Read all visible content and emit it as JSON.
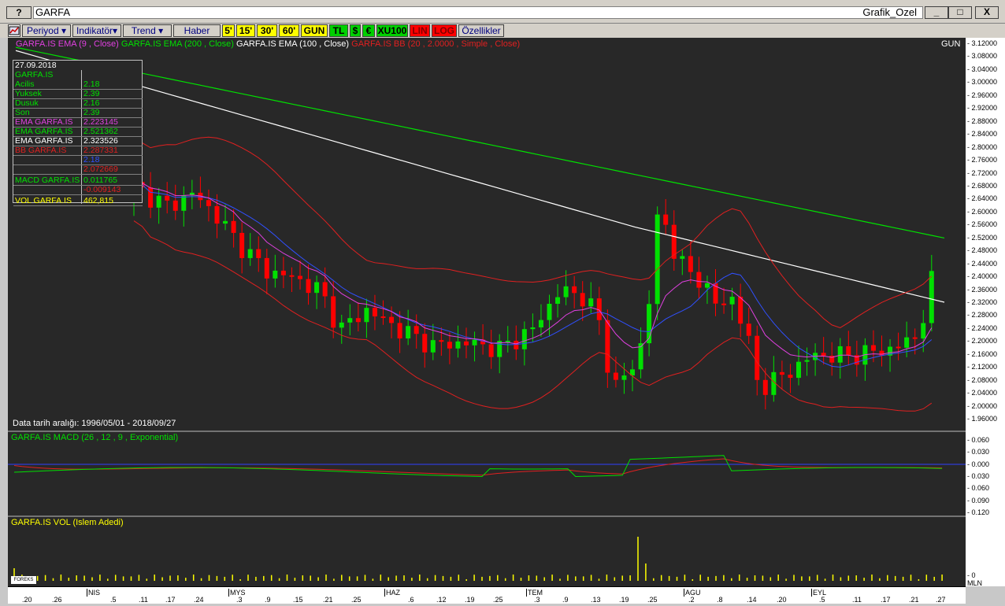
{
  "window": {
    "help_label": "?",
    "app_title": "GARFA",
    "window_title": "Grafik_Ozel",
    "minimize": "_",
    "maximize": "□",
    "close": "X"
  },
  "toolbar": {
    "periyod": "Periyod",
    "indikator": "Indikatör",
    "trend": "Trend",
    "haber": "Haber",
    "p5": "5'",
    "p15": "15'",
    "p30": "30'",
    "p60": "60'",
    "gun": "GUN",
    "tl": "TL",
    "usd": "$",
    "eur": "€",
    "xu100": "XU100",
    "lin": "LIN",
    "log": "LOG",
    "ozellikler": "Özellikler"
  },
  "legend": {
    "ema9": "GARFA.IS EMA (9 , Close)",
    "ema200": "GARFA.IS EMA (200 , Close)",
    "ema100": "GARFA.IS EMA (100 , Close)",
    "bb": "GARFA.IS BB (20 , 2.0000 , Simple , Close)",
    "period": "GUN"
  },
  "infobox": {
    "date": "27.09.2018",
    "symbol": "GARFA.IS",
    "rows": [
      {
        "label": "Acilis",
        "value": "2.18",
        "color": "#00e000"
      },
      {
        "label": "Yuksek",
        "value": "2.39",
        "color": "#00e000"
      },
      {
        "label": "Dusuk",
        "value": "2.16",
        "color": "#00e000"
      },
      {
        "label": "Son",
        "value": "2.39",
        "color": "#00e000"
      },
      {
        "label": "EMA GARFA.IS",
        "value": "2.223145",
        "color": "#e040e0"
      },
      {
        "label": "EMA GARFA.IS",
        "value": "2.521362",
        "color": "#00e000"
      },
      {
        "label": "EMA GARFA.IS",
        "value": "2.323526",
        "color": "#ffffff"
      },
      {
        "label": "BB GARFA.IS",
        "value": "2.287331",
        "color": "#e02020"
      },
      {
        "label": "",
        "value": "2.18",
        "color": "#3050ff"
      },
      {
        "label": "",
        "value": "2.072669",
        "color": "#e02020"
      },
      {
        "label": "MACD GARFA.IS",
        "value": "0.011765",
        "color": "#00e000"
      },
      {
        "label": "",
        "value": "-0.009143",
        "color": "#e02020"
      },
      {
        "label": "VOL GARFA.IS",
        "value": "462,815",
        "color": "#ffff00"
      }
    ]
  },
  "data_range": "Data tarih aralığı: 1996/05/01 - 2018/09/27",
  "macd_title": "GARFA.IS MACD (26 , 12 , 9 , Exponential)",
  "vol_title": "GARFA.IS VOL (Islem Adedi)",
  "price_ticks": [
    "3.12000",
    "3.08000",
    "3.04000",
    "3.00000",
    "2.96000",
    "2.92000",
    "2.88000",
    "2.84000",
    "2.80000",
    "2.76000",
    "2.72000",
    "2.68000",
    "2.64000",
    "2.60000",
    "2.56000",
    "2.52000",
    "2.48000",
    "2.44000",
    "2.40000",
    "2.36000",
    "2.32000",
    "2.28000",
    "2.24000",
    "2.20000",
    "2.16000",
    "2.12000",
    "2.08000",
    "2.04000",
    "2.00000",
    "1.96000"
  ],
  "macd_ticks": [
    "0.060",
    "0.030",
    "0.000",
    "0.030",
    "0.060",
    "0.090",
    "0.120"
  ],
  "vol_ticks": [
    "0",
    "MLN"
  ],
  "months": [
    {
      "label": "NIS",
      "x": 100
    },
    {
      "label": "MYS",
      "x": 280
    },
    {
      "label": "HAZ",
      "x": 478
    },
    {
      "label": "TEM",
      "x": 658
    },
    {
      "label": "AGU",
      "x": 858
    },
    {
      "label": "EYL",
      "x": 1020
    }
  ],
  "days": [
    ".20",
    ".26",
    ".5",
    ".11",
    ".17",
    ".24",
    ".3",
    ".9",
    ".15",
    ".21",
    ".25",
    ".6",
    ".12",
    ".19",
    ".25",
    ".3",
    ".9",
    ".13",
    ".19",
    ".25",
    ".2",
    ".8",
    ".14",
    ".20",
    ".5",
    ".11",
    ".17",
    ".21",
    ".27"
  ],
  "chart_data": {
    "type": "candlestick",
    "title": "GARFA",
    "ylim": [
      1.96,
      3.12
    ],
    "last": {
      "date": "27.09.2018",
      "open": 2.18,
      "high": 2.39,
      "low": 2.16,
      "close": 2.39
    },
    "colors": {
      "up": "#00e000",
      "down": "#ff0000",
      "ema9": "#e040e0",
      "ema200": "#00e000",
      "ema100": "#ffffff",
      "bb": "#e02020",
      "bb_mid": "#3050ff",
      "macd": "#00e000",
      "signal": "#e02020",
      "vol": "#ffff00"
    }
  }
}
